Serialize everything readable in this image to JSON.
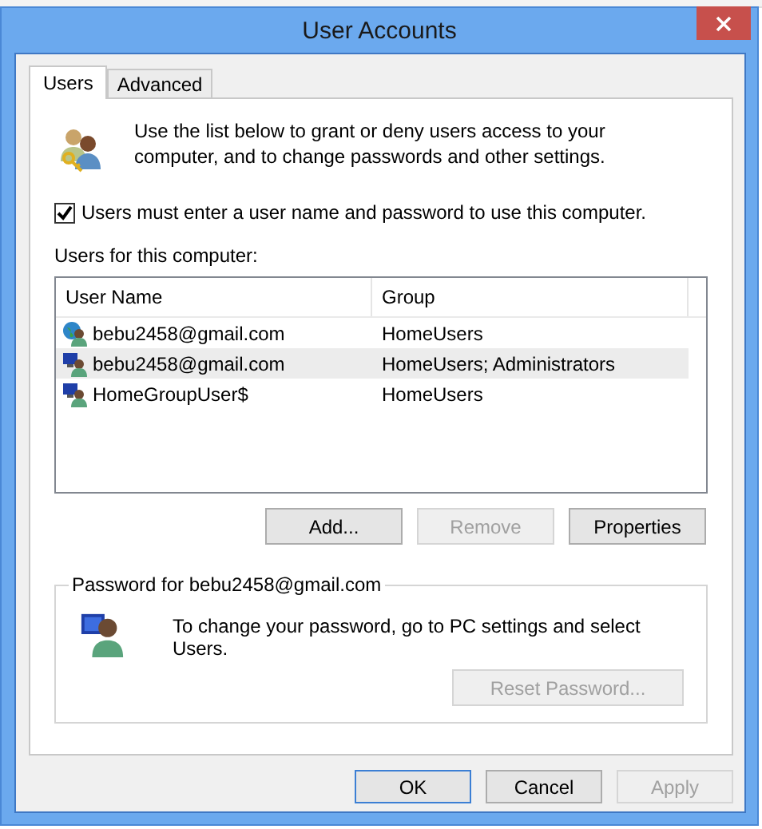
{
  "window": {
    "title": "User Accounts"
  },
  "tabs": [
    {
      "label": "Users",
      "selected": true
    },
    {
      "label": "Advanced",
      "selected": false
    }
  ],
  "intro": "Use the list below to grant or deny users access to your computer, and to change passwords and other settings.",
  "require_password": {
    "label": "Users must enter a user name and password to use this computer.",
    "checked": true
  },
  "users_label": "Users for this computer:",
  "table": {
    "columns": [
      "User Name",
      "Group"
    ],
    "rows": [
      {
        "kind": "online",
        "name": "bebu2458@gmail.com",
        "group": "HomeUsers",
        "selected": false
      },
      {
        "kind": "local",
        "name": "bebu2458@gmail.com",
        "group": "HomeUsers; Administrators",
        "selected": true
      },
      {
        "kind": "local",
        "name": "HomeGroupUser$",
        "group": "HomeUsers",
        "selected": false
      }
    ]
  },
  "list_buttons": [
    {
      "label": "Add...",
      "disabled": false
    },
    {
      "label": "Remove",
      "disabled": true
    },
    {
      "label": "Properties",
      "disabled": false
    }
  ],
  "password_group": {
    "legend": "Password for bebu2458@gmail.com",
    "message": "To change your password, go to PC settings and select Users.",
    "button": {
      "label": "Reset Password...",
      "disabled": true
    }
  },
  "dialog_buttons": [
    {
      "label": "OK",
      "disabled": false,
      "default": true
    },
    {
      "label": "Cancel",
      "disabled": false,
      "default": false
    },
    {
      "label": "Apply",
      "disabled": true,
      "default": false
    }
  ]
}
